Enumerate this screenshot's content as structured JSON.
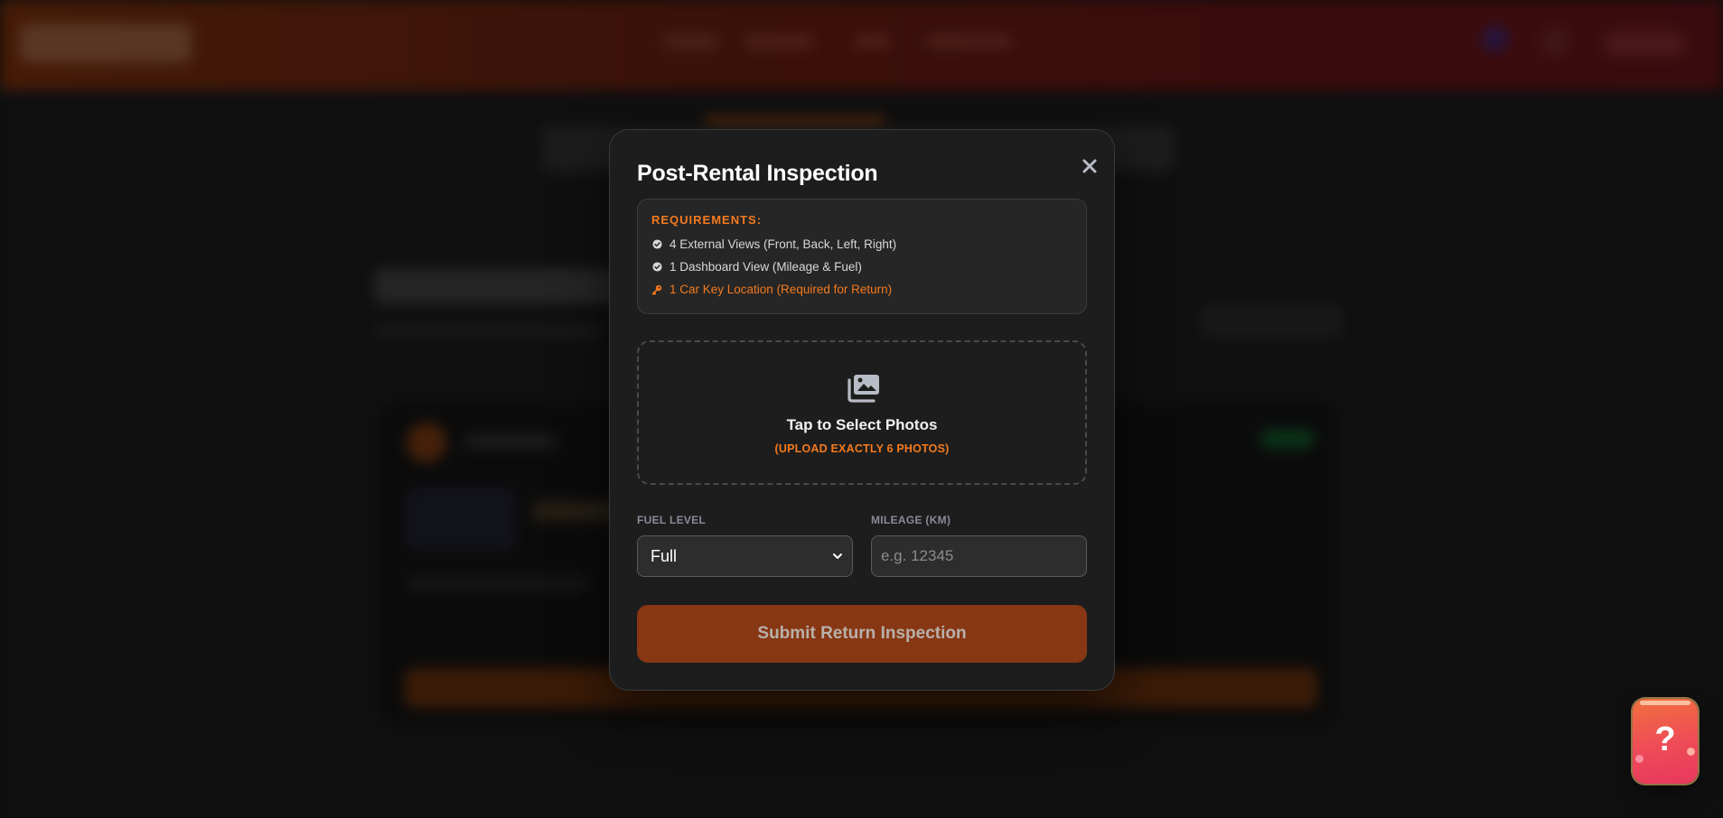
{
  "modal": {
    "title": "Post-Rental Inspection",
    "close_icon": "close-icon",
    "requirements": {
      "heading": "REQUIREMENTS:",
      "items": [
        {
          "icon": "check-circle-icon",
          "text": "4 External Views (Front, Back, Left, Right)"
        },
        {
          "icon": "check-circle-icon",
          "text": "1 Dashboard View (Mileage & Fuel)"
        },
        {
          "icon": "key-icon",
          "text": "1 Car Key Location (Required for Return)"
        }
      ]
    },
    "upload": {
      "icon": "photos-icon",
      "title": "Tap to Select Photos",
      "subtitle": "(UPLOAD EXACTLY 6 PHOTOS)"
    },
    "fuel": {
      "label": "FUEL LEVEL",
      "selected": "Full"
    },
    "mileage": {
      "label": "MILEAGE (KM)",
      "placeholder": "e.g. 12345",
      "value": ""
    },
    "submit_label": "Submit Return Inspection"
  },
  "help": {
    "label": "?"
  },
  "colors": {
    "accent": "#f37a1f",
    "submit_bg": "#873713",
    "modal_bg": "#1d1d1d",
    "help_gradient_start": "#f2703e",
    "help_gradient_end": "#e8385e"
  }
}
